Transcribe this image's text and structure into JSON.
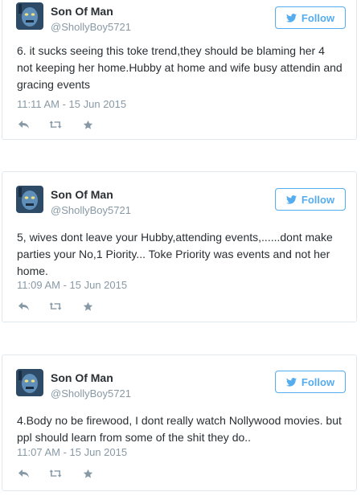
{
  "colors": {
    "accent": "#55acee",
    "text": "#292f33",
    "muted": "#8899a6",
    "border": "#e1e8ed"
  },
  "icons": {
    "follow": "twitter-bird-icon",
    "reply": "reply-icon",
    "retweet": "retweet-icon",
    "favorite": "star-icon"
  },
  "tweets": [
    {
      "author": {
        "name": "Son Of Man",
        "handle": "@ShollyBoy5721"
      },
      "follow_label": "Follow",
      "text": "6. it sucks seeing this toke trend,they should be blaming her 4 not keeping her home.Hubby at home and wife busy attendin and gracing events",
      "timestamp": "11:11 AM - 15 Jun 2015"
    },
    {
      "author": {
        "name": "Son Of Man",
        "handle": "@ShollyBoy5721"
      },
      "follow_label": "Follow",
      "text": "5, wives dont leave your Hubby,attending events,......dont make parties your No,1 Piority... Toke Priority was events and not her home.",
      "timestamp": "11:09 AM - 15 Jun 2015"
    },
    {
      "author": {
        "name": "Son Of Man",
        "handle": "@ShollyBoy5721"
      },
      "follow_label": "Follow",
      "text": "4.Body no be firewood, I dont really watch Nollywood movies. but ppl should learn from some of the shit they do..",
      "timestamp": "11:07 AM - 15 Jun 2015"
    }
  ]
}
